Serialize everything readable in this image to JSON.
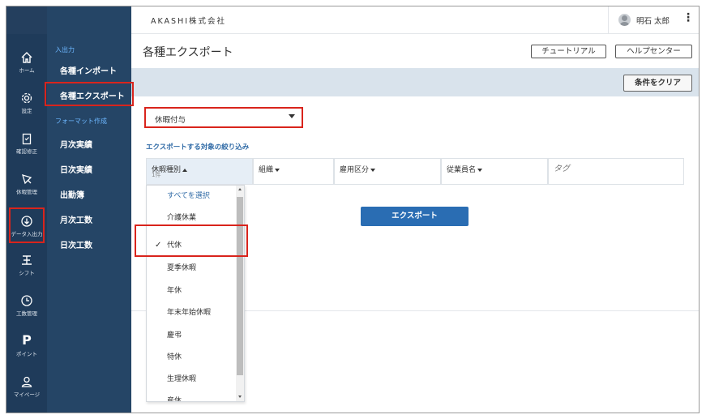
{
  "company": "AKASHI株式会社",
  "user": {
    "name": "明石 太郎",
    "menu_icon": "kebab-icon"
  },
  "rail": [
    {
      "label": "ホーム",
      "icon": "home-icon"
    },
    {
      "label": "設定",
      "icon": "gear-icon"
    },
    {
      "label": "確認修正",
      "icon": "clipboard-icon"
    },
    {
      "label": "休暇管理",
      "icon": "leave-icon"
    },
    {
      "label": "データ入出力",
      "icon": "data-io-icon"
    },
    {
      "label": "シフト",
      "icon": "shift-icon"
    },
    {
      "label": "工数管理",
      "icon": "clock-icon"
    },
    {
      "label": "ポイント",
      "icon": "point-icon"
    },
    {
      "label": "マイページ",
      "icon": "person-icon"
    }
  ],
  "submenu": {
    "section1": "入出力",
    "import": "各種インポート",
    "export": "各種エクスポート",
    "section2": "フォーマット作成",
    "items": [
      "月次実績",
      "日次実績",
      "出勤簿",
      "月次工数",
      "日次工数"
    ]
  },
  "page": {
    "title": "各種エクスポート",
    "tutorial_button": "チュートリアル",
    "help_button": "ヘルプセンター",
    "clear_button": "条件をクリア",
    "type_select_value": "休暇付与",
    "filter_label": "エクスポートする対象の絞り込み",
    "columns": {
      "leave_type": "休暇種別",
      "leave_type_count": "1件",
      "org": "組織",
      "employment": "雇用区分",
      "employee": "従業員名",
      "tag": "タグ"
    },
    "export_button": "エクスポート"
  },
  "dropdown": {
    "select_all": "すべてを選択",
    "options": [
      "介護休業",
      "代休",
      "夏季休暇",
      "年休",
      "年末年始休暇",
      "慶弔",
      "特休",
      "生理休暇",
      "産休"
    ],
    "selected": "代休"
  },
  "colors": {
    "rail_bg": "#1f3b5a",
    "submenu_bg": "#254566",
    "accent": "#2a6db3",
    "highlight": "#d9241c",
    "filterbar": "#d9e3ec"
  }
}
